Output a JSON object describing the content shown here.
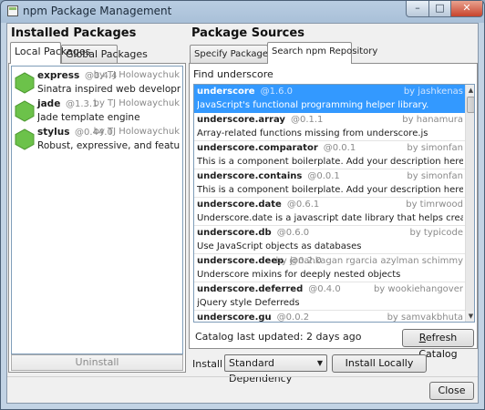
{
  "window": {
    "title": "npm Package Management",
    "minimize_glyph": "–",
    "maximize_glyph": "□",
    "close_glyph": "✕"
  },
  "installed": {
    "title": "Installed Packages",
    "tabs": [
      "Local Packages",
      "Global Packages"
    ],
    "packages": [
      {
        "name": "express",
        "version": "@3.4.4",
        "author": "by TJ Holowaychuk",
        "description": "Sinatra inspired web development framework"
      },
      {
        "name": "jade",
        "version": "@1.3.1",
        "author": "by TJ Holowaychuk",
        "description": "Jade template engine"
      },
      {
        "name": "stylus",
        "version": "@0.44.0",
        "author": "by TJ Holowaychuk",
        "description": "Robust, expressive, and feature-rich CSS sup..."
      }
    ],
    "uninstall_label": "Uninstall"
  },
  "sources": {
    "title": "Package Sources",
    "tabs": [
      "Specify Package Details",
      "Search npm Repository"
    ],
    "find_label": "Find:",
    "find_value": "underscore",
    "results": [
      {
        "name": "underscore",
        "version": "@1.6.0",
        "author": "by jashkenas",
        "description": "JavaScript's functional programming helper library."
      },
      {
        "name": "underscore.array",
        "version": "@0.1.1",
        "author": "by hanamura",
        "description": "Array-related functions missing from underscore.js"
      },
      {
        "name": "underscore.comparator",
        "version": "@0.0.1",
        "author": "by simonfan",
        "description": "This is a component boilerplate. Add your description here!"
      },
      {
        "name": "underscore.contains",
        "version": "@0.0.1",
        "author": "by simonfan",
        "description": "This is a component boilerplate. Add your description here!"
      },
      {
        "name": "underscore.date",
        "version": "@0.6.1",
        "author": "by timrwood",
        "description": "Underscore.date is a javascript date library that helps create, manipulate, and fo..."
      },
      {
        "name": "underscore.db",
        "version": "@0.6.0",
        "author": "by typicode",
        "description": "Use JavaScript objects as databases"
      },
      {
        "name": "underscore.deep",
        "version": "@0.2.0",
        "author": "by jonahkagan rgarcia azylman schimmy",
        "description": "Underscore mixins for deeply nested objects"
      },
      {
        "name": "underscore.deferred",
        "version": "@0.4.0",
        "author": "by wookiehangover",
        "description": "jQuery style Deferreds"
      },
      {
        "name": "underscore.gu",
        "version": "@0.0.2",
        "author": "by samvakbhuta",
        "description": ""
      }
    ],
    "catalog_status": "Catalog last updated: 2 days ago",
    "refresh_label": "Refresh Catalog",
    "install_as_label": "Install As:",
    "install_as_value": "Standard Dependency",
    "install_locally_label": "Install Locally"
  },
  "close_label": "Close",
  "colors": {
    "selection": "#3399ff",
    "node_hex": "#6cc24a"
  },
  "icons": {
    "app": "npm-app-icon",
    "package": "node-hexagon-icon"
  }
}
